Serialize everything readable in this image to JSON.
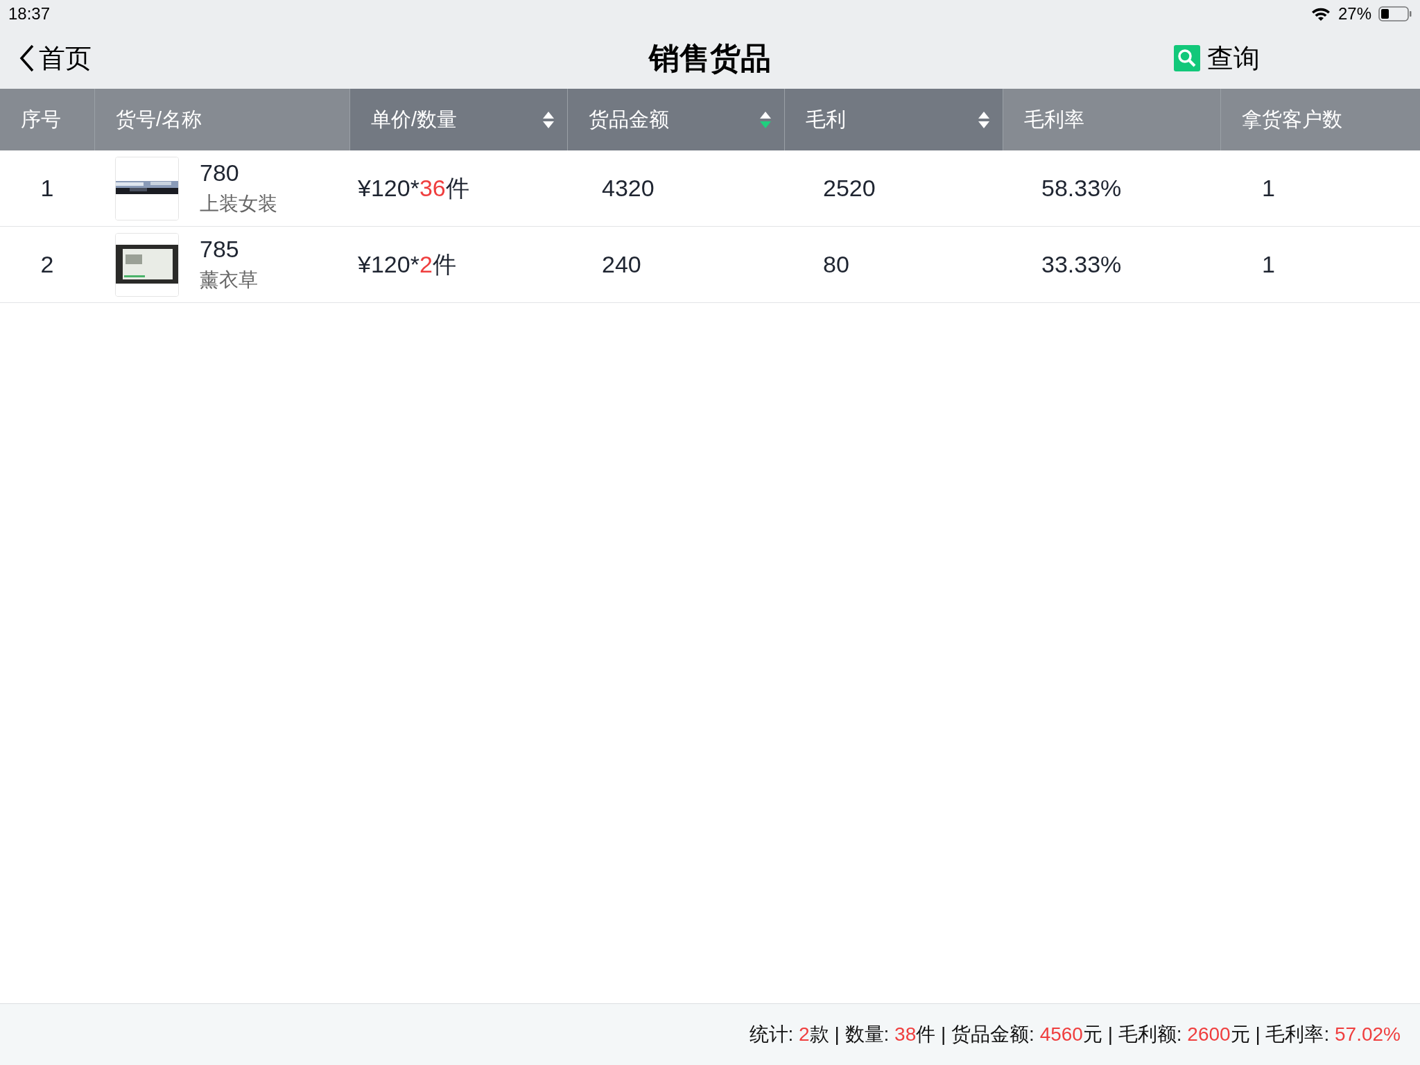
{
  "status_bar": {
    "time": "18:37",
    "battery": "27%"
  },
  "nav": {
    "back": "首页",
    "title": "销售货品",
    "search": "查询"
  },
  "table": {
    "columns": [
      {
        "label": "序号",
        "kind": "plain"
      },
      {
        "label": "货号/名称",
        "kind": "plain"
      },
      {
        "label": "单价/数量",
        "kind": "sortable",
        "sorted": false
      },
      {
        "label": "货品金额",
        "kind": "sortable",
        "sorted": true
      },
      {
        "label": "毛利",
        "kind": "sortable",
        "sorted": false
      },
      {
        "label": "毛利率",
        "kind": "plain"
      },
      {
        "label": "拿货客户数",
        "kind": "plain"
      }
    ],
    "rows": [
      {
        "index": "1",
        "code": "780",
        "name": "上装女装",
        "price": "¥120*",
        "qty": "36",
        "unit": "件",
        "amount": "4320",
        "profit": "2520",
        "rate": "58.33%",
        "customers": "1"
      },
      {
        "index": "2",
        "code": "785",
        "name": "薰衣草",
        "price": "¥120*",
        "qty": "2",
        "unit": "件",
        "amount": "240",
        "profit": "80",
        "rate": "33.33%",
        "customers": "1"
      }
    ]
  },
  "summary": {
    "separator": "|",
    "items": [
      {
        "label": "统计:",
        "value": "2",
        "unit": "款"
      },
      {
        "label": "数量:",
        "value": "38",
        "unit": "件"
      },
      {
        "label": "货品金额:",
        "value": "4560",
        "unit": "元"
      },
      {
        "label": "毛利额:",
        "value": "2600",
        "unit": "元"
      },
      {
        "label": "毛利率:",
        "value": "57.02%"
      }
    ]
  }
}
